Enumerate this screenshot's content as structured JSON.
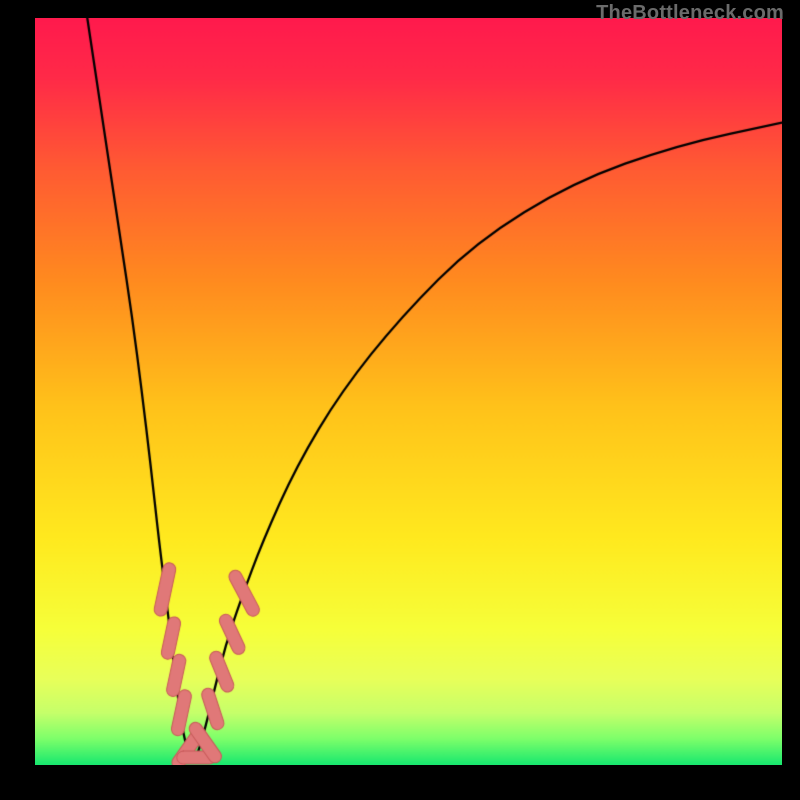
{
  "watermark": "TheBottleneck.com",
  "chart_data": {
    "type": "line",
    "title": "",
    "xlabel": "",
    "ylabel": "",
    "xlim": [
      0,
      100
    ],
    "ylim": [
      0,
      100
    ],
    "grid": false,
    "legend": null,
    "background_gradient_stops": [
      {
        "pos": 0.0,
        "color": "#ff1a4d"
      },
      {
        "pos": 0.08,
        "color": "#ff2a48"
      },
      {
        "pos": 0.2,
        "color": "#ff5a33"
      },
      {
        "pos": 0.35,
        "color": "#ff8a1f"
      },
      {
        "pos": 0.52,
        "color": "#ffc21a"
      },
      {
        "pos": 0.7,
        "color": "#ffea1f"
      },
      {
        "pos": 0.82,
        "color": "#f6ff3a"
      },
      {
        "pos": 0.885,
        "color": "#e8ff5a"
      },
      {
        "pos": 0.93,
        "color": "#c6ff6a"
      },
      {
        "pos": 0.965,
        "color": "#7dff6a"
      },
      {
        "pos": 1.0,
        "color": "#17e86f"
      }
    ],
    "series": [
      {
        "name": "left-branch",
        "stroke": "#000000",
        "width": 2.3,
        "points": [
          {
            "x": 7.0,
            "y": 100.0
          },
          {
            "x": 8.5,
            "y": 90.0
          },
          {
            "x": 10.0,
            "y": 80.0
          },
          {
            "x": 11.5,
            "y": 70.0
          },
          {
            "x": 13.0,
            "y": 60.0
          },
          {
            "x": 14.3,
            "y": 50.0
          },
          {
            "x": 15.5,
            "y": 40.0
          },
          {
            "x": 16.6,
            "y": 30.0
          },
          {
            "x": 17.6,
            "y": 22.0
          },
          {
            "x": 18.3,
            "y": 16.0
          },
          {
            "x": 19.0,
            "y": 10.0
          },
          {
            "x": 19.7,
            "y": 5.0
          },
          {
            "x": 20.5,
            "y": 1.5
          },
          {
            "x": 21.0,
            "y": 0.3
          }
        ]
      },
      {
        "name": "right-branch",
        "stroke": "#000000",
        "width": 2.3,
        "points": [
          {
            "x": 21.0,
            "y": 0.3
          },
          {
            "x": 21.8,
            "y": 1.5
          },
          {
            "x": 22.8,
            "y": 5.0
          },
          {
            "x": 24.0,
            "y": 10.0
          },
          {
            "x": 25.5,
            "y": 16.0
          },
          {
            "x": 27.5,
            "y": 22.0
          },
          {
            "x": 30.5,
            "y": 30.0
          },
          {
            "x": 35.0,
            "y": 40.0
          },
          {
            "x": 41.0,
            "y": 50.0
          },
          {
            "x": 49.0,
            "y": 60.0
          },
          {
            "x": 59.0,
            "y": 70.0
          },
          {
            "x": 72.0,
            "y": 78.0
          },
          {
            "x": 86.0,
            "y": 83.0
          },
          {
            "x": 100.0,
            "y": 86.0
          }
        ]
      }
    ],
    "markers": {
      "shape": "capsule",
      "fill": "#e07878",
      "stroke": "#c85a5a",
      "items": [
        {
          "x": 17.4,
          "y": 23.5,
          "len": 5.5,
          "angle": 78
        },
        {
          "x": 18.2,
          "y": 17.0,
          "len": 4.0,
          "angle": 78
        },
        {
          "x": 18.9,
          "y": 12.0,
          "len": 4.0,
          "angle": 78
        },
        {
          "x": 19.6,
          "y": 7.0,
          "len": 4.5,
          "angle": 78
        },
        {
          "x": 20.5,
          "y": 2.2,
          "len": 4.5,
          "angle": 55
        },
        {
          "x": 21.6,
          "y": 1.0,
          "len": 3.5,
          "angle": 0
        },
        {
          "x": 22.8,
          "y": 3.0,
          "len": 4.5,
          "angle": -55
        },
        {
          "x": 23.8,
          "y": 7.5,
          "len": 4.0,
          "angle": -72
        },
        {
          "x": 25.0,
          "y": 12.5,
          "len": 4.0,
          "angle": -68
        },
        {
          "x": 26.4,
          "y": 17.5,
          "len": 4.0,
          "angle": -65
        },
        {
          "x": 28.0,
          "y": 23.0,
          "len": 5.0,
          "angle": -62
        }
      ]
    }
  }
}
